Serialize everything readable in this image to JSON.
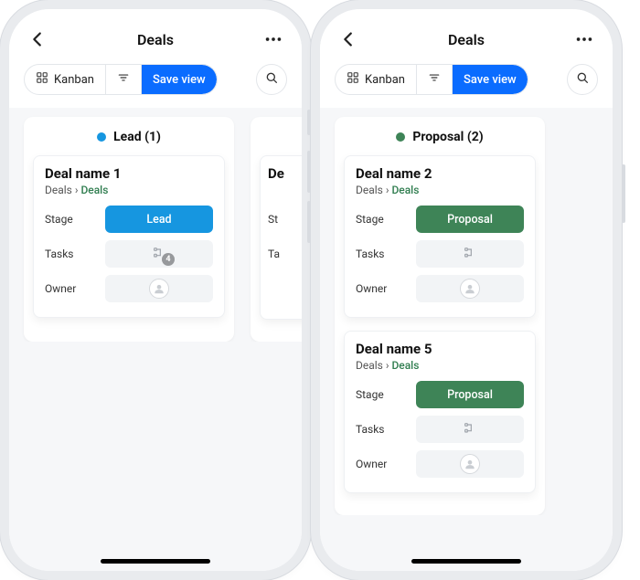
{
  "colors": {
    "lead": "#1696e0",
    "proposal": "#3e8457",
    "accent": "#0a6cff"
  },
  "header": {
    "title": "Deals"
  },
  "toolbar": {
    "view_label": "Kanban",
    "save_label": "Save view"
  },
  "phones": [
    {
      "column": {
        "dot_color_key": "lead",
        "title": "Lead (1)",
        "cards": [
          {
            "title": "Deal name 1",
            "crumb_root": "Deals",
            "crumb_leaf": "Deals",
            "rows": {
              "stage_label": "Stage",
              "stage_value": "Lead",
              "stage_color_key": "lead",
              "tasks_label": "Tasks",
              "tasks_count": "4",
              "owner_label": "Owner"
            }
          }
        ]
      },
      "peek_card": {
        "title_fragment": "De",
        "rows": {
          "stage_label_fragment": "St",
          "tasks_label_fragment": "Ta"
        }
      }
    },
    {
      "column": {
        "dot_color_key": "proposal",
        "title": "Proposal (2)",
        "cards": [
          {
            "title": "Deal name 2",
            "crumb_root": "Deals",
            "crumb_leaf": "Deals",
            "rows": {
              "stage_label": "Stage",
              "stage_value": "Proposal",
              "stage_color_key": "proposal",
              "tasks_label": "Tasks",
              "tasks_count": "",
              "owner_label": "Owner"
            }
          },
          {
            "title": "Deal name 5",
            "crumb_root": "Deals",
            "crumb_leaf": "Deals",
            "rows": {
              "stage_label": "Stage",
              "stage_value": "Proposal",
              "stage_color_key": "proposal",
              "tasks_label": "Tasks",
              "tasks_count": "",
              "owner_label": "Owner"
            }
          }
        ]
      },
      "peek_card": null
    }
  ]
}
